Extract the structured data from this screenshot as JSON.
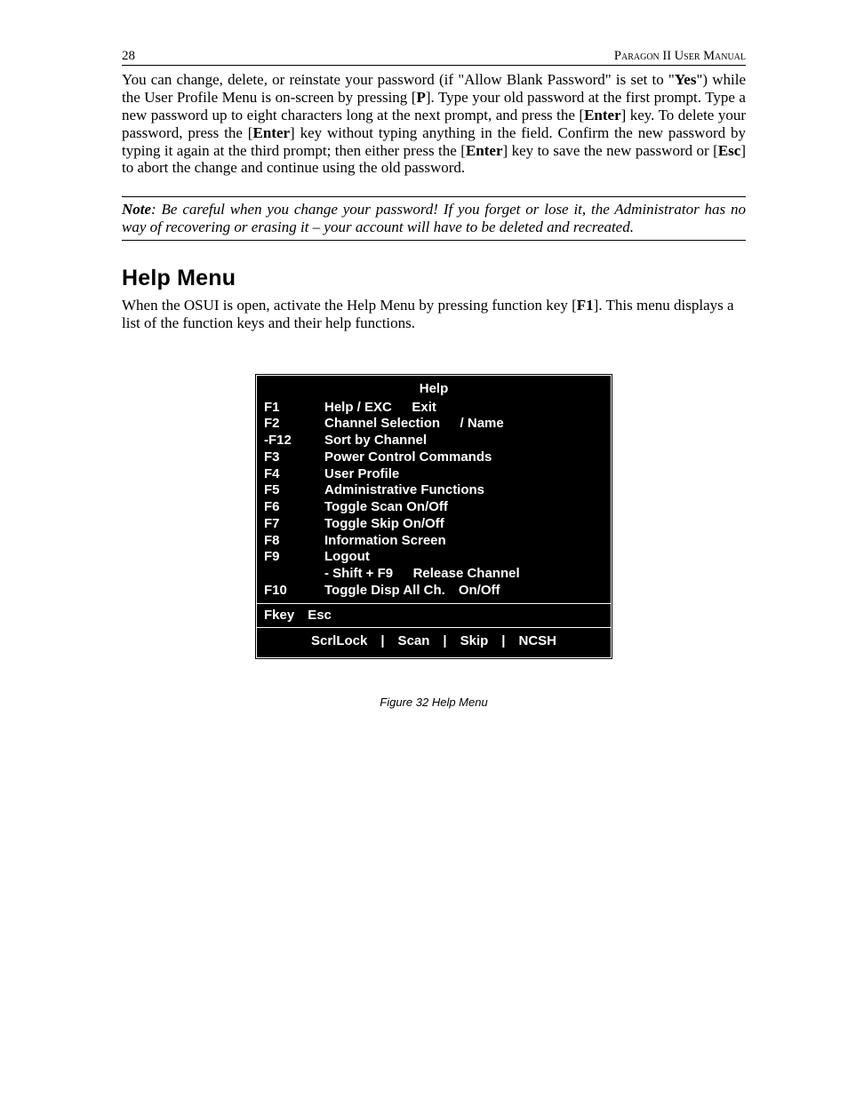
{
  "header": {
    "page_number": "28",
    "doc_title": "Paragon II User Manual"
  },
  "para1": {
    "t1": "You can change, delete, or reinstate your password (if \"Allow Blank Password\" is set to \"",
    "yes": "Yes",
    "t2": "\") while the User Profile Menu is on-screen by pressing [",
    "p": "P",
    "t3": "]. Type your old password at the first prompt. Type a new password up to eight characters long at the next prompt, and press the [",
    "enter1": "Enter",
    "t4": "] key. To delete your password, press the [",
    "enter2": "Enter",
    "t5": "] key without typing anything in the field. Confirm the new password by typing it again at the third prompt; then either press the [",
    "enter3": "Enter",
    "t6": "] key to save the new password or [",
    "esc": "Esc",
    "t7": "] to abort the change and continue using the old password."
  },
  "note": {
    "label": "Note",
    "text": ": Be careful when you change your password! If you forget or lose it, the Administrator has no way of recovering or erasing it – your account will have to be deleted and recreated."
  },
  "section_heading": "Help Menu",
  "para2": {
    "t1": "When the OSUI is open, activate the Help Menu by pressing function key [",
    "f1": "F1",
    "t2": "]. This menu displays a list of the function keys and their help functions."
  },
  "osui": {
    "title": "Help",
    "rows": [
      {
        "key": "F1",
        "desc": "Help / EXC  Exit"
      },
      {
        "key": "F2",
        "desc": "Channel Selection  / Name"
      },
      {
        "key": "-F12",
        "desc": "Sort by Channel"
      },
      {
        "key": "F3",
        "desc": "Power Control Commands"
      },
      {
        "key": "F4",
        "desc": "User Profile"
      },
      {
        "key": "F5",
        "desc": "Administrative Functions"
      },
      {
        "key": "F6",
        "desc": "Toggle Scan On/Off"
      },
      {
        "key": "F7",
        "desc": "Toggle Skip On/Off"
      },
      {
        "key": "F8",
        "desc": "Information Screen"
      },
      {
        "key": "F9",
        "desc": "Logout"
      }
    ],
    "shift_row": "- Shift + F9  Release Channel",
    "f10": {
      "key": "F10",
      "desc": "Toggle Disp All Ch. On/Off"
    },
    "fkey_row": "Fkey  Esc",
    "status": "ScrlLock  |  Scan  |  Skip  |  NCSH"
  },
  "figure_caption": "Figure 32 Help Menu"
}
